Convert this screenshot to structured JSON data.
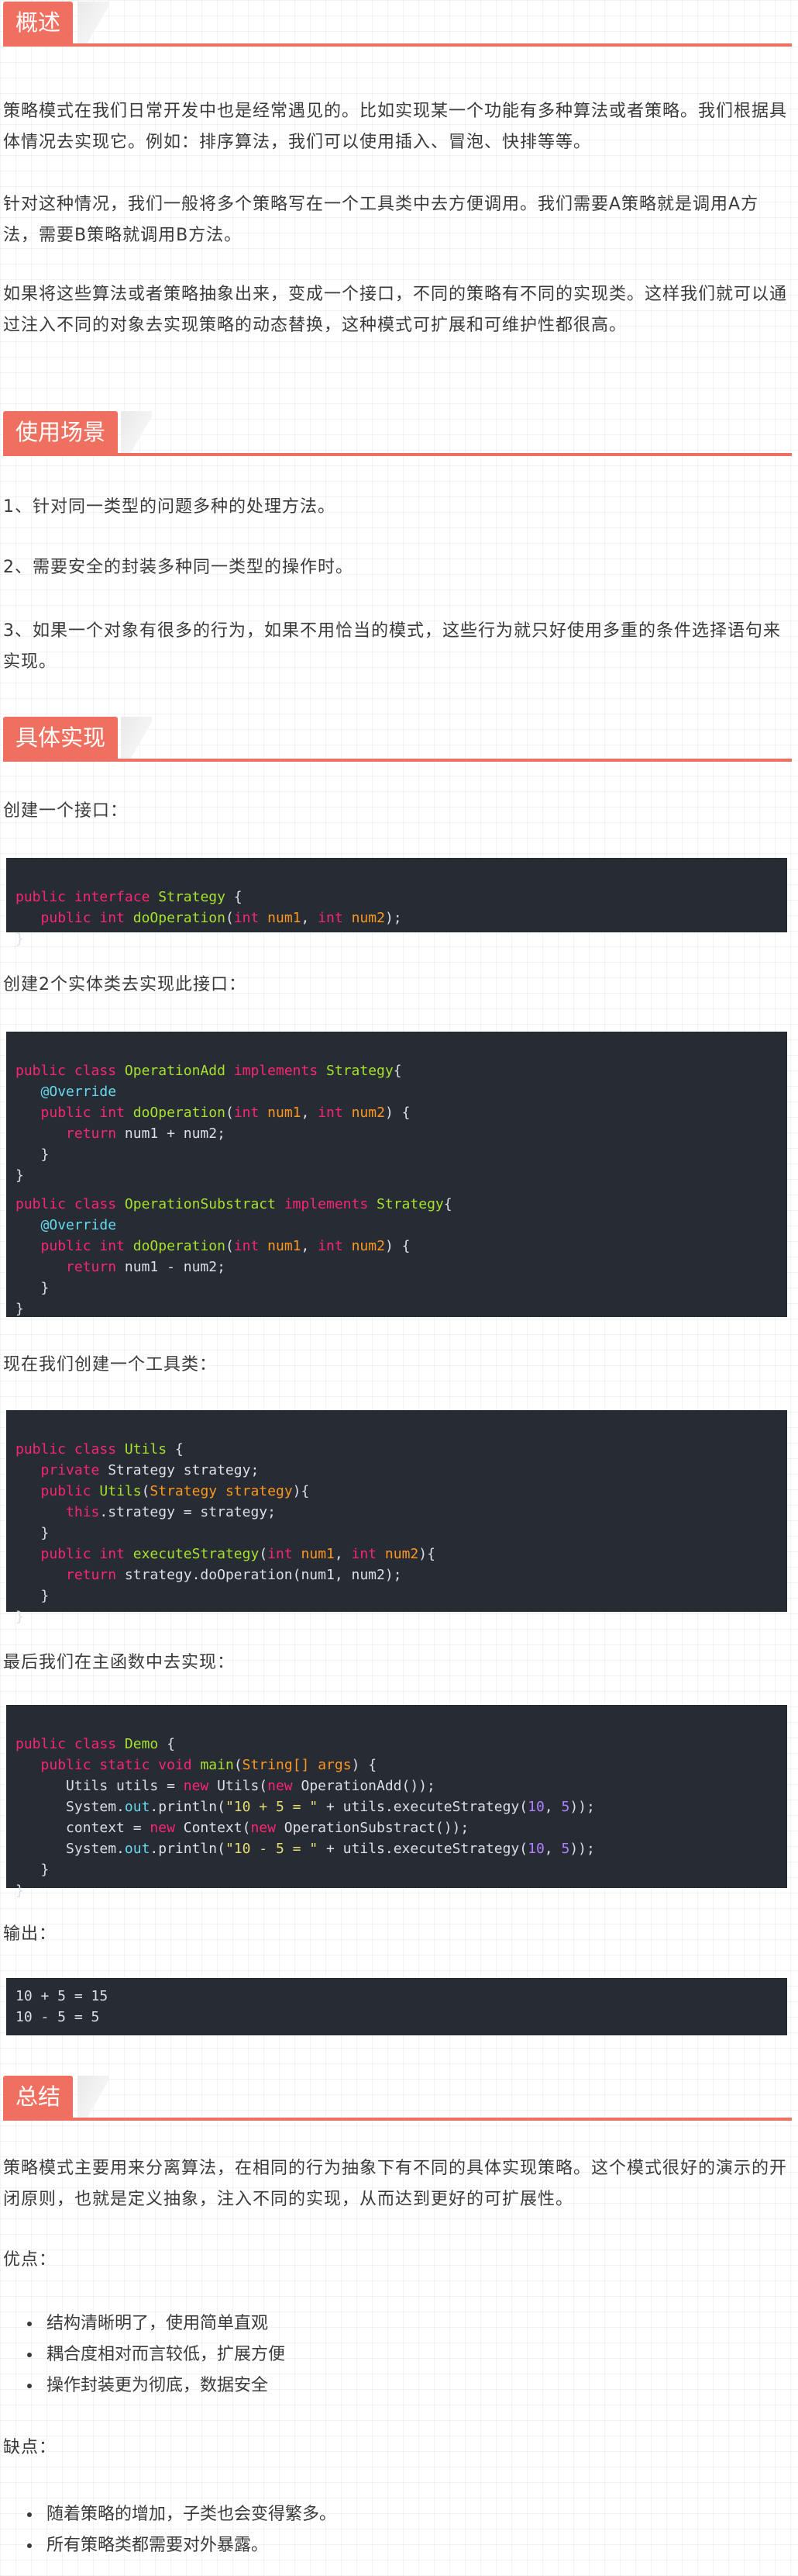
{
  "sections": {
    "overview": {
      "title": "概述",
      "paragraphs": [
        "策略模式在我们日常开发中也是经常遇见的。比如实现某一个功能有多种算法或者策略。我们根据具体情况去实现它。例如：排序算法，我们可以使用插入、冒泡、快排等等。",
        "针对这种情况，我们一般将多个策略写在一个工具类中去方便调用。我们需要A策略就是调用A方法，需要B策略就调用B方法。",
        "如果将这些算法或者策略抽象出来，变成一个接口，不同的策略有不同的实现类。这样我们就可以通过注入不同的对象去实现策略的动态替换，这种模式可扩展和可维护性都很高。"
      ]
    },
    "scenarios": {
      "title": "使用场景",
      "items": [
        "1、针对同一类型的问题多种的处理方法。",
        "2、需要安全的封装多种同一类型的操作时。",
        "3、如果一个对象有很多的行为，如果不用恰当的模式，这些行为就只好使用多重的条件选择语句来实现。"
      ]
    },
    "implementation": {
      "title": "具体实现",
      "step1": "创建一个接口：",
      "step2": "创建2个实体类去实现此接口：",
      "step3": "现在我们创建一个工具类：",
      "step4": "最后我们在主函数中去实现：",
      "output_label": "输出：",
      "code_interface": "public interface Strategy {\n   public int doOperation(int num1, int num2);\n}",
      "code_classes": "public class OperationAdd implements Strategy{\n   @Override\n   public int doOperation(int num1, int num2) {\n      return num1 + num2;\n   }\n}\npublic class OperationSubstract implements Strategy{\n   @Override\n   public int doOperation(int num1, int num2) {\n      return num1 - num2;\n   }\n}",
      "code_utils": "public class Utils {\n   private Strategy strategy;\n   public Utils(Strategy strategy){\n      this.strategy = strategy;\n   }\n   public int executeStrategy(int num1, int num2){\n      return strategy.doOperation(num1, num2);\n   }\n}",
      "code_demo": "public class Demo {\n   public static void main(String[] args) {\n      Utils utils = new Utils(new OperationAdd());\n      System.out.println(\"10 + 5 = \" + utils.executeStrategy(10, 5));\n      context = new Context(new OperationSubstract());\n      System.out.println(\"10 - 5 = \" + utils.executeStrategy(10, 5));\n   }\n}",
      "code_output": "10 + 5 = 15\n10 - 5 = 5"
    },
    "summary": {
      "title": "总结",
      "paragraph": "策略模式主要用来分离算法，在相同的行为抽象下有不同的具体实现策略。这个模式很好的演示的开闭原则，也就是定义抽象，注入不同的实现，从而达到更好的可扩展性。",
      "pros_label": "优点：",
      "pros": [
        "结构清晰明了，使用简单直观",
        "耦合度相对而言较低，扩展方便",
        "操作封装更为彻底，数据安全"
      ],
      "cons_label": "缺点：",
      "cons": [
        "随着策略的增加，子类也会变得繁多。",
        "所有策略类都需要对外暴露。"
      ]
    }
  },
  "colors": {
    "accent": "#ef7060",
    "code_bg": "#272b33"
  }
}
